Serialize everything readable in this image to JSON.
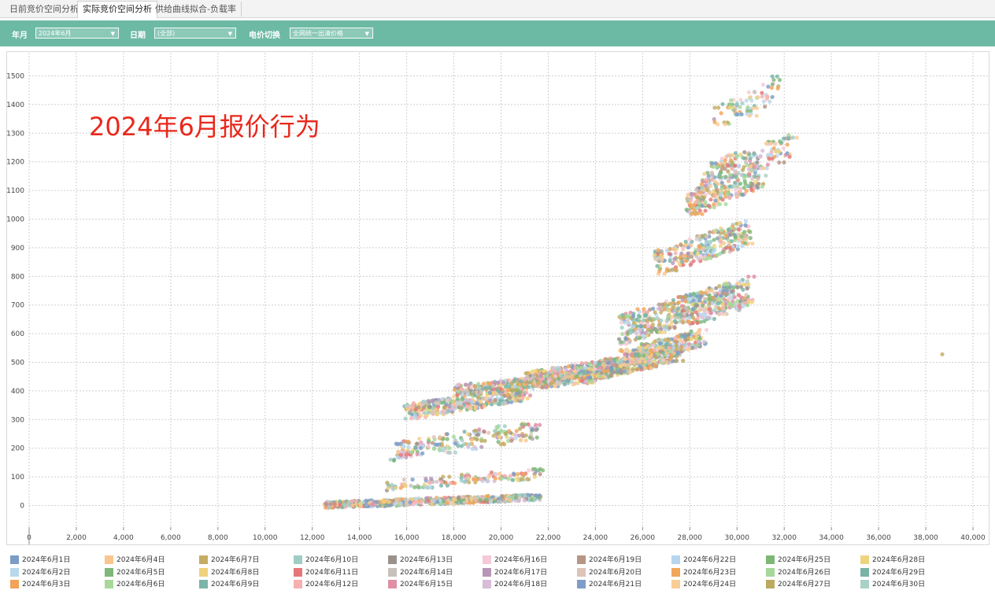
{
  "tabs": [
    {
      "label": "日前竞价空间分析",
      "active": false
    },
    {
      "label": "实际竞价空间分析",
      "active": true
    },
    {
      "label": "供给曲线拟合-负载率",
      "active": false
    }
  ],
  "filters": {
    "year_month_label": "年月",
    "year_month_value": "2024年6月",
    "date_label": "日期",
    "date_value": "(全部)",
    "price_label": "电价切换",
    "price_value": "全网统一出清价格"
  },
  "colors": {
    "toolbar": "#6dbaa4",
    "annotation": "#e8281c"
  },
  "chart_data": {
    "type": "scatter",
    "annotation": "2024年6月报价行为",
    "xlim": [
      0,
      40000
    ],
    "ylim": [
      -80,
      1580
    ],
    "x_ticks": [
      "0",
      "2,000",
      "4,000",
      "6,000",
      "8,000",
      "10,000",
      "12,000",
      "14,000",
      "16,000",
      "18,000",
      "20,000",
      "22,000",
      "24,000",
      "26,000",
      "28,000",
      "30,000",
      "32,000",
      "34,000",
      "36,000",
      "38,000",
      "40,000"
    ],
    "y_ticks": [
      "0",
      "100",
      "200",
      "300",
      "400",
      "500",
      "600",
      "700",
      "800",
      "900",
      "1000",
      "1100",
      "1200",
      "1300",
      "1400",
      "1500"
    ],
    "grid": true,
    "legend_position": "bottom",
    "series": [
      {
        "name": "2024年6月1日",
        "color": "#7b9cc5"
      },
      {
        "name": "2024年6月2日",
        "color": "#b9d8ea"
      },
      {
        "name": "2024年6月3日",
        "color": "#f0a35a"
      },
      {
        "name": "2024年6月4日",
        "color": "#f9c68f"
      },
      {
        "name": "2024年6月5日",
        "color": "#7fb87a"
      },
      {
        "name": "2024年6月6日",
        "color": "#a8d99a"
      },
      {
        "name": "2024年6月7日",
        "color": "#c5ad63"
      },
      {
        "name": "2024年6月8日",
        "color": "#f0d27a"
      },
      {
        "name": "2024年6月9日",
        "color": "#7ab5a8"
      },
      {
        "name": "2024年6月10日",
        "color": "#9fcdc5"
      },
      {
        "name": "2024年6月11日",
        "color": "#e47878"
      },
      {
        "name": "2024年6月12日",
        "color": "#f6b0b0"
      },
      {
        "name": "2024年6月13日",
        "color": "#9a928c"
      },
      {
        "name": "2024年6月14日",
        "color": "#c8c1bb"
      },
      {
        "name": "2024年6月15日",
        "color": "#e08ea5"
      },
      {
        "name": "2024年6月16日",
        "color": "#f6c9d6"
      },
      {
        "name": "2024年6月17日",
        "color": "#b896b8"
      },
      {
        "name": "2024年6月18日",
        "color": "#d8bcd8"
      },
      {
        "name": "2024年6月19日",
        "color": "#b79584"
      },
      {
        "name": "2024年6月20日",
        "color": "#dcc4b6"
      },
      {
        "name": "2024年6月21日",
        "color": "#7f9dc8"
      },
      {
        "name": "2024年6月22日",
        "color": "#b7d5ef"
      },
      {
        "name": "2024年6月23日",
        "color": "#f2a65c"
      },
      {
        "name": "2024年6月24日",
        "color": "#f8cd96"
      },
      {
        "name": "2024年6月25日",
        "color": "#7db877"
      },
      {
        "name": "2024年6月26日",
        "color": "#a6d899"
      },
      {
        "name": "2024年6月27日",
        "color": "#bcaa60"
      },
      {
        "name": "2024年6月28日",
        "color": "#efd480"
      },
      {
        "name": "2024年6月29日",
        "color": "#79b3a6"
      },
      {
        "name": "2024年6月30日",
        "color": "#a9d1c7"
      }
    ],
    "clusters": [
      {
        "x": [
          12500,
          21500
        ],
        "y": [
          -10,
          40
        ],
        "n": 480
      },
      {
        "x": [
          15000,
          21800
        ],
        "y": [
          50,
          130
        ],
        "n": 90
      },
      {
        "x": [
          15300,
          21500
        ],
        "y": [
          150,
          300
        ],
        "n": 150
      },
      {
        "x": [
          15900,
          21000
        ],
        "y": [
          300,
          420
        ],
        "n": 260
      },
      {
        "x": [
          18000,
          24000
        ],
        "y": [
          380,
          470
        ],
        "n": 260
      },
      {
        "x": [
          21000,
          25000
        ],
        "y": [
          420,
          520
        ],
        "n": 230
      },
      {
        "x": [
          24000,
          27500
        ],
        "y": [
          440,
          560
        ],
        "n": 260
      },
      {
        "x": [
          25000,
          28500
        ],
        "y": [
          480,
          620
        ],
        "n": 230
      },
      {
        "x": [
          25000,
          30500
        ],
        "y": [
          560,
          800
        ],
        "n": 380
      },
      {
        "x": [
          26500,
          30500
        ],
        "y": [
          800,
          1000
        ],
        "n": 200
      },
      {
        "x": [
          27800,
          31000
        ],
        "y": [
          1000,
          1200
        ],
        "n": 180
      },
      {
        "x": [
          28500,
          32300
        ],
        "y": [
          1100,
          1300
        ],
        "n": 120
      },
      {
        "x": [
          29000,
          31800
        ],
        "y": [
          1300,
          1500
        ],
        "n": 50
      }
    ],
    "outliers": [
      {
        "x": 38700,
        "y": 528
      },
      {
        "x": 31500,
        "y": 1498
      },
      {
        "x": 31700,
        "y": 1498
      }
    ]
  }
}
